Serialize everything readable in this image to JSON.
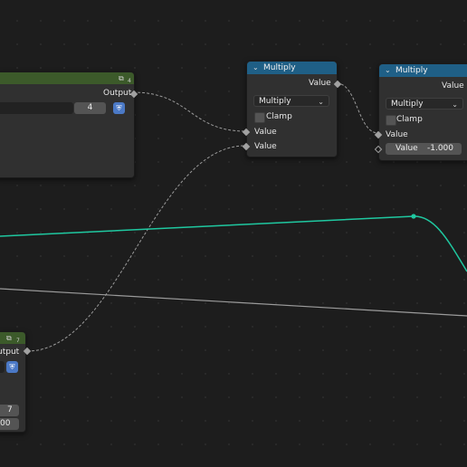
{
  "editor": "Node Editor",
  "nodes": {
    "multiply1": {
      "title": "Multiply",
      "output_label": "Value",
      "operation": "Multiply",
      "clamp_label": "Clamp",
      "input1_label": "Value",
      "input2_label": "Value"
    },
    "multiply2": {
      "title": "Multiply",
      "output_label": "Value",
      "operation": "Multiply",
      "clamp_label": "Clamp",
      "input1_label": "Value",
      "input2_field_label": "Value",
      "input2_field_value": "-1.000"
    },
    "group_node_top": {
      "user_count": "4",
      "output_label": "Output",
      "datablock_users": "4"
    },
    "group_node_bottom": {
      "user_count": "7",
      "output_label": "utput",
      "field1_value": "7",
      "field2_value": "00"
    }
  },
  "colors": {
    "header_math": "#1f5f86",
    "header_group": "#3c5a2a",
    "fcurve": "#1fc8a0",
    "wire": "#9a9a9a"
  },
  "icons": {
    "shield": "fake-user-shield-icon",
    "datablock": "node-group-datablock-icon",
    "collapse": "chevron-down-icon"
  }
}
